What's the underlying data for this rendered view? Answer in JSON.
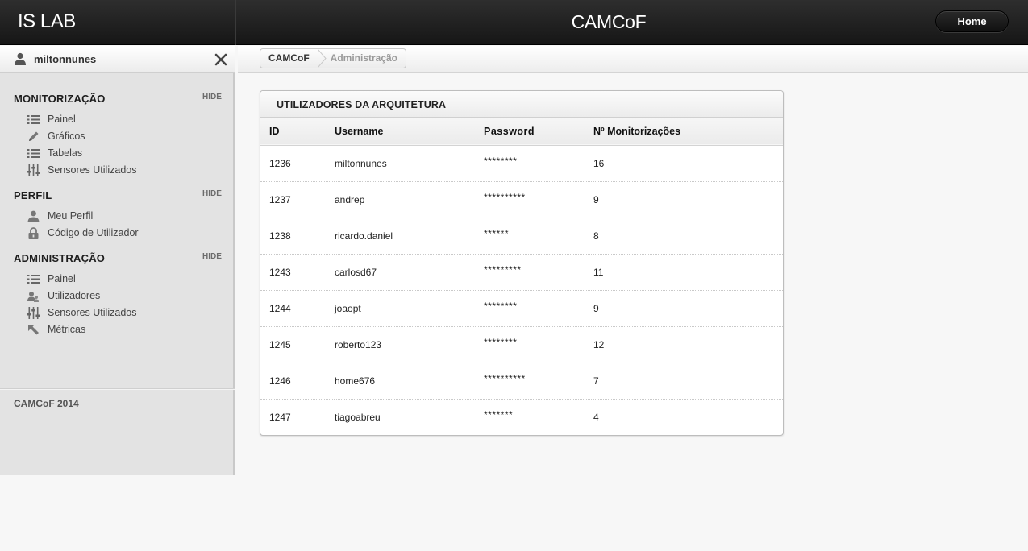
{
  "header": {
    "brand": "IS LAB",
    "title": "CAMCoF",
    "home_label": "Home"
  },
  "sidebar": {
    "username": "miltonnunes",
    "hide_label": "HIDE",
    "sections": [
      {
        "title": "MONITORIZAÇÃO",
        "items": [
          {
            "label": "Painel",
            "icon": "list-icon"
          },
          {
            "label": "Gráficos",
            "icon": "pencil-icon"
          },
          {
            "label": "Tabelas",
            "icon": "list-icon"
          },
          {
            "label": "Sensores Utilizados",
            "icon": "sliders-icon"
          }
        ]
      },
      {
        "title": "PERFIL",
        "items": [
          {
            "label": "Meu Perfil",
            "icon": "user-icon"
          },
          {
            "label": "Código de Utilizador",
            "icon": "lock-icon"
          }
        ]
      },
      {
        "title": "ADMINISTRAÇÃO",
        "items": [
          {
            "label": "Painel",
            "icon": "list-icon"
          },
          {
            "label": "Utilizadores",
            "icon": "users-icon"
          },
          {
            "label": "Sensores Utilizados",
            "icon": "sliders-icon"
          },
          {
            "label": "Métricas",
            "icon": "cursor-icon"
          }
        ]
      }
    ],
    "footer": "CAMCoF 2014"
  },
  "breadcrumb": [
    "CAMCoF",
    "Administração"
  ],
  "panel": {
    "title": "UTILIZADORES DA ARQUITETURA",
    "columns": [
      "ID",
      "Username",
      "Password",
      "Nº Monitorizações"
    ],
    "rows": [
      [
        "1236",
        "miltonnunes",
        "********",
        "16"
      ],
      [
        "1237",
        "andrep",
        "**********",
        "9"
      ],
      [
        "1238",
        "ricardo.daniel",
        "******",
        "8"
      ],
      [
        "1243",
        "carlosd67",
        "*********",
        "11"
      ],
      [
        "1244",
        "joaopt",
        "********",
        "9"
      ],
      [
        "1245",
        "roberto123",
        "********",
        "12"
      ],
      [
        "1246",
        "home676",
        "**********",
        "7"
      ],
      [
        "1247",
        "tiagoabreu",
        "*******",
        "4"
      ]
    ]
  },
  "colors": {
    "topbar": "#1e1e1e",
    "sidebar": "#e3e3e3",
    "page": "#f7f7f7",
    "panel": "#ffffff"
  }
}
